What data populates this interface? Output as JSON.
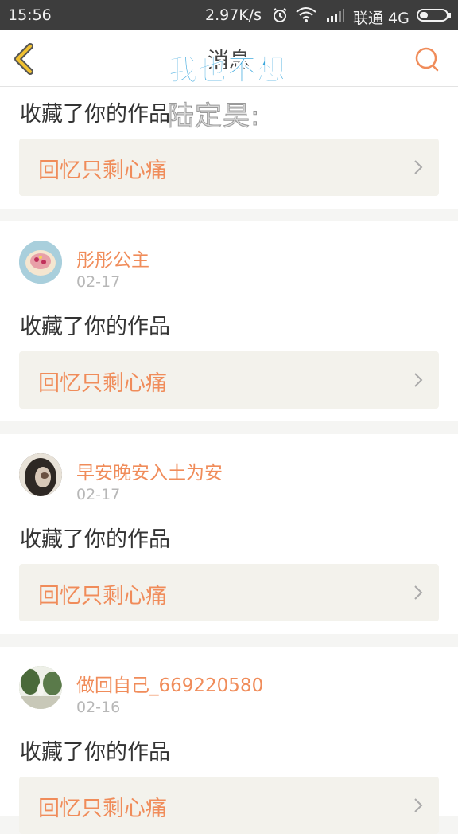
{
  "status_bar": {
    "time": "15:56",
    "network_speed": "2.97K/s",
    "carrier": "联通 4G"
  },
  "header": {
    "title": "消息",
    "overlay_text": "我也不想"
  },
  "banner_subtext": "陆定昊:",
  "notifications": [
    {
      "avatar": "avatar-cake",
      "username": "",
      "date": "",
      "action": "收藏了你的作品",
      "work_title": "回忆只剩心痛"
    },
    {
      "avatar": "avatar-cake",
      "username": "彤彤公主",
      "date": "02-17",
      "action": "收藏了你的作品",
      "work_title": "回忆只剩心痛"
    },
    {
      "avatar": "avatar-girl",
      "username": "早安晚安入土为安",
      "date": "02-17",
      "action": "收藏了你的作品",
      "work_title": "回忆只剩心痛"
    },
    {
      "avatar": "avatar-landscape",
      "username": "做回自己_669220580",
      "date": "02-16",
      "action": "收藏了你的作品",
      "work_title": "回忆只剩心痛"
    }
  ],
  "colors": {
    "accent": "#f08c5a",
    "overlay": "#3aa7dd",
    "back_arrow": "#f0c030"
  }
}
